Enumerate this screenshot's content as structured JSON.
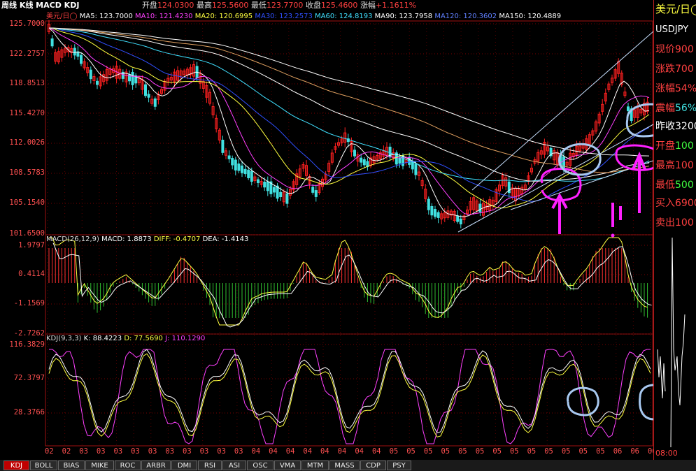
{
  "header": {
    "title": "周线 K线 MACD KDJ",
    "quote": [
      {
        "label": "开盘",
        "value": "124.0300"
      },
      {
        "label": "最高",
        "value": "125.5600"
      },
      {
        "label": "最低",
        "value": "123.7700"
      },
      {
        "label": "收盘",
        "value": "125.4600"
      },
      {
        "label": "涨幅",
        "value": "+1.1611%"
      }
    ]
  },
  "main_panel": {
    "label": "美元/日◯",
    "ma": [
      {
        "name": "MA5: 123.7000",
        "color": "#ffffff"
      },
      {
        "name": "MA10: 121.4230",
        "color": "#ff40ff"
      },
      {
        "name": "MA20: 120.6995",
        "color": "#ffff40"
      },
      {
        "name": "MA30: 123.2573",
        "color": "#3050ff"
      },
      {
        "name": "MA60: 124.8193",
        "color": "#40e0ff"
      },
      {
        "name": "MA90: 123.7958",
        "color": "#ffffff"
      },
      {
        "name": "MA120: 120.3602",
        "color": "#6080ff"
      },
      {
        "name": "MA150: 120.4889",
        "color": "#ffffff"
      }
    ],
    "yticks": [
      "125.7000",
      "122.2757",
      "118.8513",
      "115.4270",
      "112.0026",
      "108.5783",
      "105.1540",
      "101.6500"
    ]
  },
  "macd_panel": {
    "label": "MACD(26,12,9)",
    "values": [
      {
        "name": "MACD: 1.8873",
        "color": "#ffffff"
      },
      {
        "name": "DIFF: -0.4707",
        "color": "#ffff40"
      },
      {
        "name": "DEA: -1.4143",
        "color": "#ffffff"
      }
    ],
    "yticks": [
      "1.9797",
      "0.4114",
      "-1.1569",
      "-2.7262"
    ]
  },
  "kdj_panel": {
    "label": "KDJ(9,3,3)",
    "values": [
      {
        "name": "K: 88.4223",
        "color": "#ffffff"
      },
      {
        "name": "D: 77.5690",
        "color": "#ffff40"
      },
      {
        "name": "J: 110.1290",
        "color": "#ff40ff"
      }
    ],
    "yticks": [
      "116.3829",
      "72.3797",
      "28.3766"
    ]
  },
  "xaxis": [
    "02",
    "02",
    "03",
    "03",
    "03",
    "03",
    "03",
    "03",
    "03",
    "03",
    "03",
    "03",
    "04",
    "04",
    "04",
    "04",
    "04",
    "04",
    "04",
    "04",
    "05",
    "05",
    "05",
    "05",
    "05",
    "05",
    "05",
    "05",
    "05",
    "05",
    "05",
    "05",
    "05",
    "06",
    "06",
    "06"
  ],
  "right_panel": {
    "title": "美元/日◯",
    "symbol": "USDJPY",
    "rows": [
      {
        "label": "现价",
        "value": "900"
      },
      {
        "label": "涨跌",
        "value": "700"
      },
      {
        "label": "涨幅",
        "value": "54%"
      },
      {
        "label": "震幅",
        "value": "56%"
      },
      {
        "label": "昨收",
        "value": "3200"
      },
      {
        "label": "开盘",
        "value": "100"
      },
      {
        "label": "最高",
        "value": "100"
      },
      {
        "label": "最低",
        "value": "500"
      },
      {
        "label": "买入",
        "value": "6900"
      },
      {
        "label": "卖出",
        "value": "100"
      }
    ],
    "time": "08:00"
  },
  "tabs": [
    "KDJ",
    "BOLL",
    "BIAS",
    "MIKE",
    "ROC",
    "ARBR",
    "DMI",
    "RSI",
    "ASI",
    "OSC",
    "VMA",
    "MTM",
    "MASS",
    "CDP",
    "PSY"
  ],
  "colors": {
    "up": "#ff3030",
    "down": "#40e0e0",
    "grid": "#8b0000",
    "annotation_magenta": "#ff20ff",
    "annotation_blue": "#a8c8f0"
  }
}
